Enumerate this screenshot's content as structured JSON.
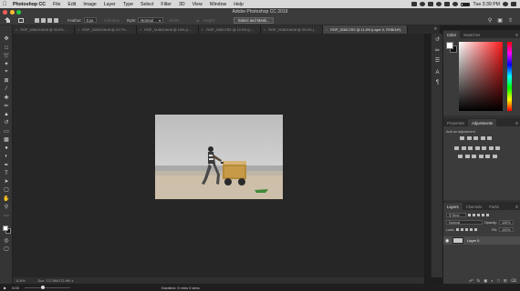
{
  "menubar": {
    "app": "Photoshop CC",
    "items": [
      "File",
      "Edit",
      "Image",
      "Layer",
      "Type",
      "Select",
      "Filter",
      "3D",
      "View",
      "Window",
      "Help"
    ],
    "clock": "Tue 3:39 PM"
  },
  "window": {
    "title": "Adobe Photoshop CC 2019"
  },
  "options": {
    "feather_label": "Feather:",
    "feather_value": "0 px",
    "antialias_label": "Anti-alias",
    "style_label": "Style:",
    "style_value": "Normal",
    "width_label": "Width:",
    "height_label": "Height:",
    "select_mask_label": "Select and Mask..."
  },
  "tabs": [
    {
      "label": "RGP_3364-Edit.tif @ 33.6%...",
      "active": false
    },
    {
      "label": "RGP_3328-Edit.tif @ 24.7%...",
      "active": false
    },
    {
      "label": "RGP_3148-Edit.tif @ 15% (L...",
      "active": false
    },
    {
      "label": "RGP_3369.CR2 @ 12.5% (L...",
      "active": false
    },
    {
      "label": "RGP_3158-Edit.tif @ 33.3% (...",
      "active": false
    },
    {
      "label": "RGP_3260.CR2 @ 11.6% (Layer 0, RGB/16*)",
      "active": true
    }
  ],
  "status": {
    "zoom": "11.6%",
    "doc": "Doc: 172.9M/172.9M"
  },
  "playback": {
    "current": "0:00",
    "duration": "Duration: 3 mins 0 secs"
  },
  "color_panel": {
    "tabs": [
      "Color",
      "Swatches"
    ],
    "foreground": "#ffffff",
    "background": "#111111"
  },
  "adjust_panel": {
    "tabs": [
      "Properties",
      "Adjustments"
    ],
    "add_label": "Add an adjustment"
  },
  "layers_panel": {
    "tabs": [
      "Layers",
      "Channels",
      "Paths"
    ],
    "kind": "Kind",
    "blend_mode": "Normal",
    "opacity_label": "Opacity:",
    "opacity_value": "100%",
    "lock_label": "Lock:",
    "fill_label": "Fill:",
    "fill_value": "100%",
    "layers": [
      {
        "name": "Layer 0"
      }
    ]
  }
}
